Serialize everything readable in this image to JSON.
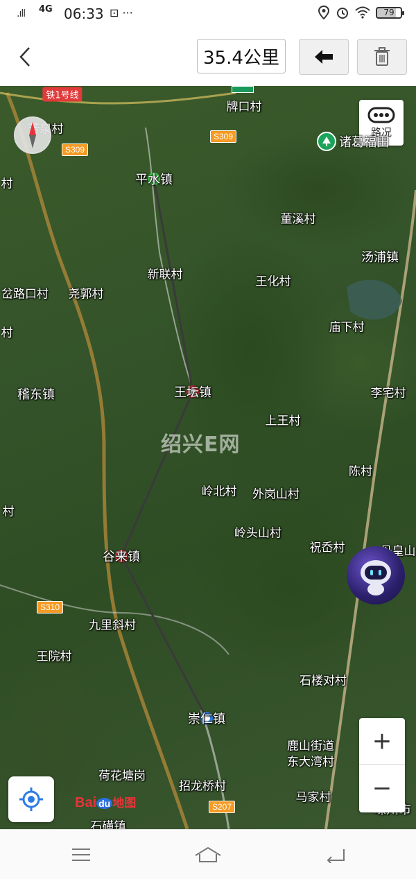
{
  "status_bar": {
    "signal": ".ıll",
    "network": "4G",
    "time": "06:33",
    "extra": "⊡ ···",
    "battery": "79"
  },
  "toolbar": {
    "back_icon": "chevron-left-icon",
    "distance": "35.4公里",
    "undo_icon": "arrow-left-icon",
    "delete_icon": "trash-icon"
  },
  "map": {
    "traffic_label": "路况",
    "poi_label": "诸葛福田",
    "watermark": "绍兴E网",
    "zoom_in": "+",
    "zoom_out": "−",
    "logo": {
      "bai": "Bai",
      "du": "du",
      "ditu": "地图"
    },
    "route_color": "#3a3a3a",
    "start_marker_color": "#3ad64a",
    "mid_marker_color": "#e8333a",
    "end_marker_color": "#2c7be5",
    "places": [
      {
        "name": "牌口村"
      },
      {
        "name": "芳泉村"
      },
      {
        "name": "平水镇"
      },
      {
        "name": "村"
      },
      {
        "name": "董溪村"
      },
      {
        "name": "汤浦镇"
      },
      {
        "name": "新联村"
      },
      {
        "name": "王化村"
      },
      {
        "name": "岔路口村"
      },
      {
        "name": "尧郭村"
      },
      {
        "name": "村"
      },
      {
        "name": "庙下村"
      },
      {
        "name": "稽东镇"
      },
      {
        "name": "王坛镇"
      },
      {
        "name": "李宅村"
      },
      {
        "name": "上王村"
      },
      {
        "name": "陈村"
      },
      {
        "name": "岭北村"
      },
      {
        "name": "外岗山村"
      },
      {
        "name": "村"
      },
      {
        "name": "岭头山村"
      },
      {
        "name": "祝岙村"
      },
      {
        "name": "丹皇山"
      },
      {
        "name": "谷来镇"
      },
      {
        "name": "九里斜村"
      },
      {
        "name": "王院村"
      },
      {
        "name": "石楼对村"
      },
      {
        "name": "崇仁镇"
      },
      {
        "name": "鹿山街道"
      },
      {
        "name": "东大湾村"
      },
      {
        "name": "荷花塘岗"
      },
      {
        "name": "招龙桥村"
      },
      {
        "name": "马家村"
      },
      {
        "name": "石磺镇"
      },
      {
        "name": "嵊州市"
      }
    ],
    "roads": [
      "S309",
      "S309",
      "S310",
      "S207"
    ],
    "rail": "铁1号线"
  },
  "navbar": {
    "menu_icon": "menu-icon",
    "home_icon": "home-icon",
    "back_icon": "back-icon"
  }
}
